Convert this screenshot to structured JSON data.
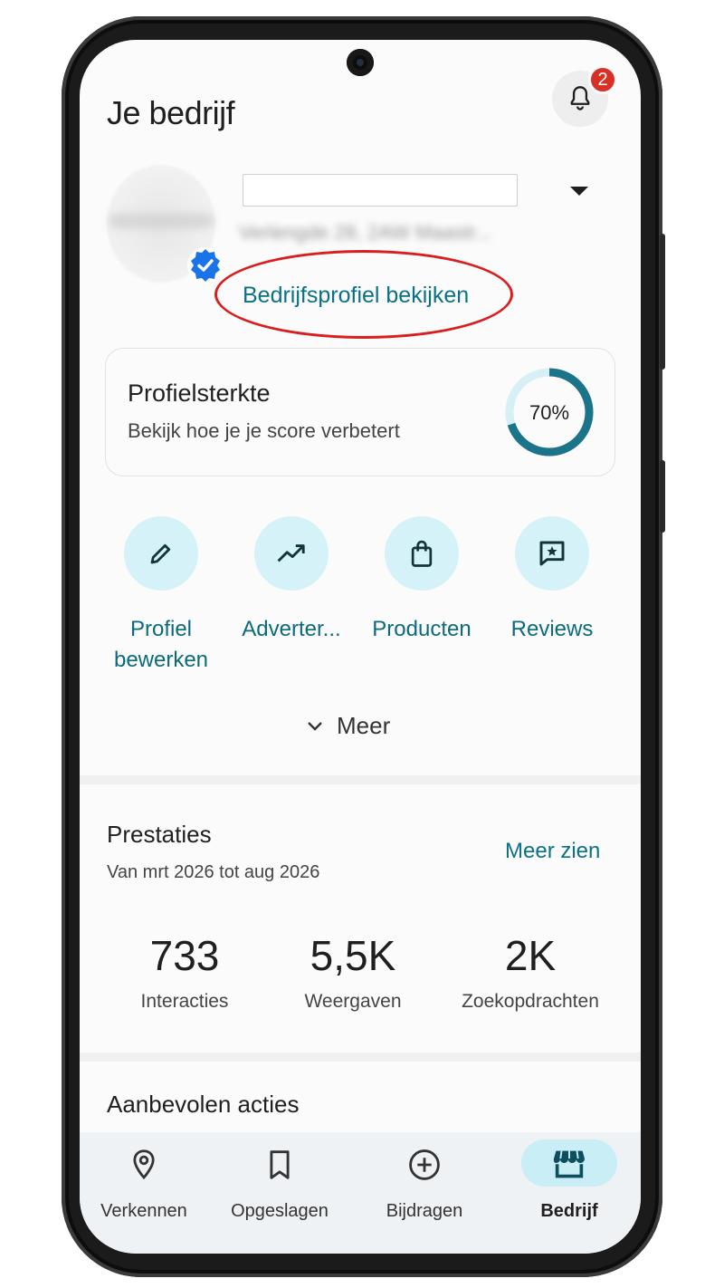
{
  "header": {
    "title": "Je bedrijf",
    "notification_count": "2"
  },
  "profile": {
    "address_blurred": "Verlengde 28, 2AW Maastr...",
    "view_profile_link": "Bedrijfsprofiel bekijken"
  },
  "strength": {
    "title": "Profielsterkte",
    "subtitle": "Bekijk hoe je je score verbetert",
    "percent_label": "70%",
    "percent": 70
  },
  "actions": [
    {
      "label_line1": "Profiel",
      "label_line2": "bewerken",
      "icon": "pencil-icon"
    },
    {
      "label_line1": "Adverter...",
      "icon": "trending-up-icon"
    },
    {
      "label_line1": "Producten",
      "icon": "shopping-bag-icon"
    },
    {
      "label_line1": "Reviews",
      "icon": "star-review-icon"
    }
  ],
  "more": {
    "label": "Meer"
  },
  "performance": {
    "title": "Prestaties",
    "period": "Van mrt 2026 tot aug 2026",
    "see_more": "Meer zien",
    "stats": [
      {
        "value": "733",
        "label": "Interacties"
      },
      {
        "value": "5,5K",
        "label": "Weergaven"
      },
      {
        "value": "2K",
        "label": "Zoekopdrachten"
      }
    ]
  },
  "recommended": {
    "title": "Aanbevolen acties"
  },
  "nav": [
    {
      "label": "Verkennen",
      "icon": "location-pin-icon"
    },
    {
      "label": "Opgeslagen",
      "icon": "bookmark-icon"
    },
    {
      "label": "Bijdragen",
      "icon": "add-circle-icon"
    },
    {
      "label": "Bedrijf",
      "icon": "storefront-icon",
      "active": true
    }
  ],
  "colors": {
    "accent": "#0b7285",
    "badge": "#d93025",
    "highlight_oval": "#d81e1e",
    "chip_bg": "#d4f2f8"
  }
}
